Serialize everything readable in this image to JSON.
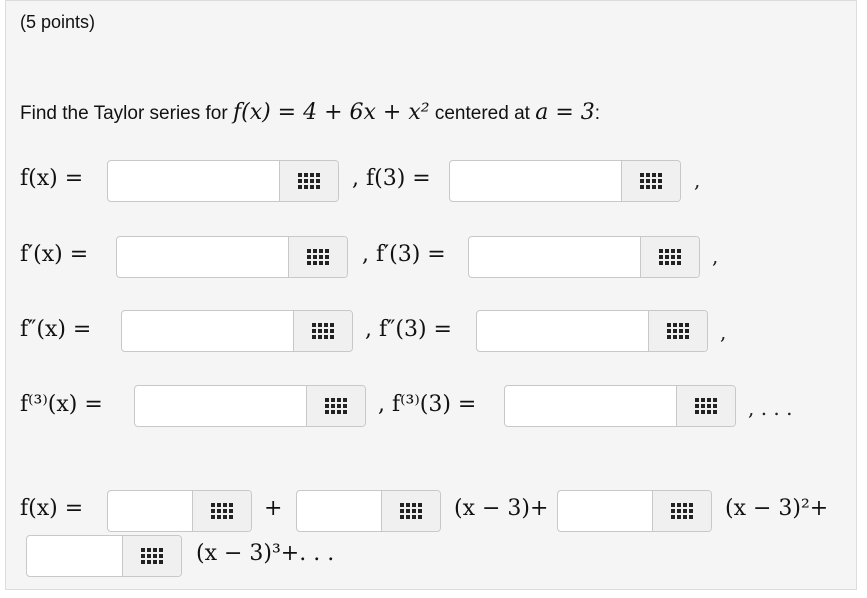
{
  "header": {
    "points": "(5 points)"
  },
  "question": {
    "prefix": "Find the Taylor series for ",
    "function_expr": "f(x) = 4 + 6x + x²",
    "middle": " centered at ",
    "center_expr": "a = 3",
    "suffix": ":"
  },
  "rows": [
    {
      "label": "f(x) =",
      "value_label": "f(3) =",
      "trail": ","
    },
    {
      "label": "f′(x) =",
      "value_label": "f′(3) =",
      "trail": ","
    },
    {
      "label": "f″(x) =",
      "value_label": "f″(3) =",
      "trail": ","
    },
    {
      "label": "f⁽³⁾(x) =",
      "value_label": "f⁽³⁾(3) =",
      "trail": ",  . . ."
    }
  ],
  "series": {
    "label": "f(x) =",
    "plus": "+",
    "term1": "(x − 3)+",
    "term2": "(x − 3)²+",
    "term3": "(x − 3)³+. . ."
  },
  "icons": {
    "keyboard": "keyboard-grid-icon"
  }
}
